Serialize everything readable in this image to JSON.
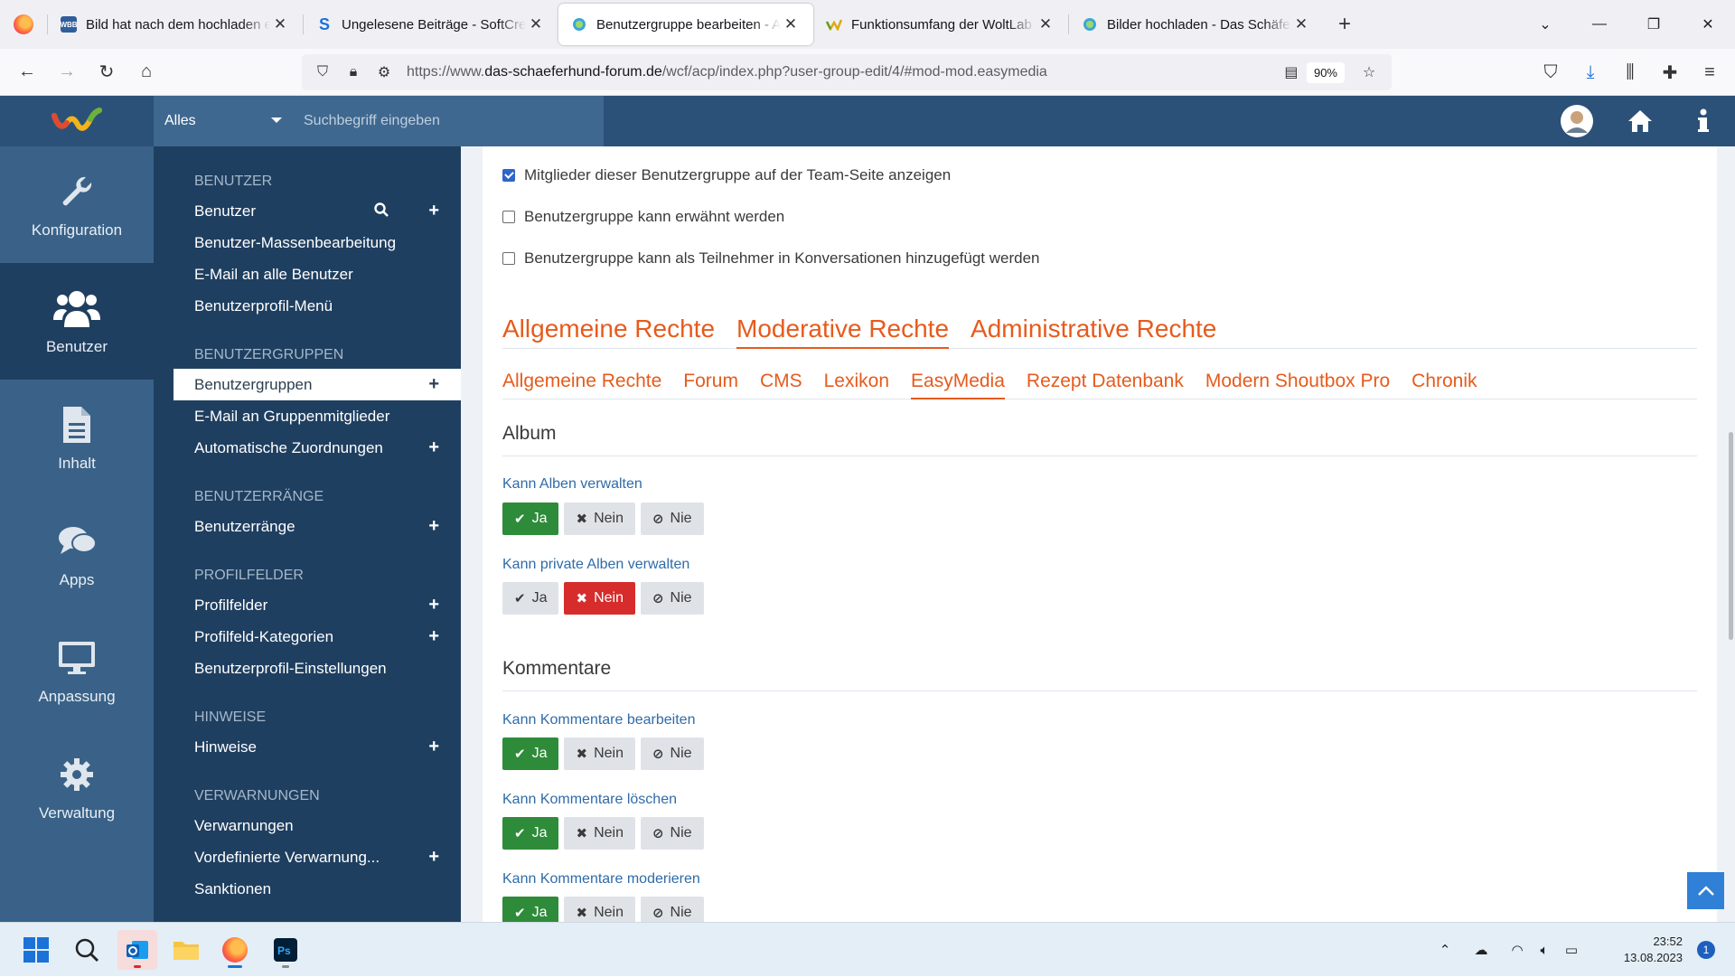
{
  "browser": {
    "tabs": [
      {
        "title": "Bild hat nach dem hochladen ein",
        "favicon": "wbb-favicon",
        "active": false
      },
      {
        "title": "Ungelesene Beiträge - SoftCrea",
        "favicon": "softcreatr-favicon",
        "active": false
      },
      {
        "title": "Benutzergruppe bearbeiten - Ad",
        "favicon": "schaeferhund-favicon",
        "active": true
      },
      {
        "title": "Funktionsumfang der WoltLab Su",
        "favicon": "woltlab-favicon",
        "active": false
      },
      {
        "title": "Bilder hochladen - Das Schäferh",
        "favicon": "schaeferhund-favicon",
        "active": false
      }
    ],
    "url_scheme": "https://www.",
    "url_domain": "das-schaeferhund-forum.de",
    "url_path": "/wcf/acp/index.php?user-group-edit/4/#mod-mod.easymedia",
    "zoom": "90%"
  },
  "acp": {
    "search_type": "Alles",
    "search_placeholder": "Suchbegriff eingeben",
    "main_menu": [
      {
        "label": "Konfiguration",
        "icon": "wrench-icon"
      },
      {
        "label": "Benutzer",
        "icon": "users-icon",
        "active": true
      },
      {
        "label": "Inhalt",
        "icon": "document-icon"
      },
      {
        "label": "Apps",
        "icon": "comments-icon"
      },
      {
        "label": "Anpassung",
        "icon": "monitor-icon"
      },
      {
        "label": "Verwaltung",
        "icon": "gear-icon"
      }
    ],
    "sub_menu": {
      "benutzer": {
        "heading": "Benutzer",
        "items": [
          "Benutzer",
          "Benutzer-Massenbearbeitung",
          "E-Mail an alle Benutzer",
          "Benutzerprofil-Menü"
        ]
      },
      "gruppen": {
        "heading": "Benutzergruppen",
        "items": [
          "Benutzergruppen",
          "E-Mail an Gruppenmitglieder",
          "Automatische Zuordnungen"
        ]
      },
      "raenge": {
        "heading": "Benutzerränge",
        "items": [
          "Benutzerränge"
        ]
      },
      "profilfelder": {
        "heading": "Profilfelder",
        "items": [
          "Profilfelder",
          "Profilfeld-Kategorien",
          "Benutzerprofil-Einstellungen"
        ]
      },
      "hinweise": {
        "heading": "Hinweise",
        "items": [
          "Hinweise"
        ]
      },
      "verwarnungen": {
        "heading": "Verwarnungen",
        "items": [
          "Verwarnungen",
          "Vordefinierte Verwarnung...",
          "Sanktionen"
        ]
      }
    },
    "checkboxes": [
      {
        "label": "Mitglieder dieser Benutzergruppe auf der Team-Seite anzeigen",
        "checked": true
      },
      {
        "label": "Benutzergruppe kann erwähnt werden",
        "checked": false
      },
      {
        "label": "Benutzergruppe kann als Teilnehmer in Konversationen hinzugefügt werden",
        "checked": false
      }
    ],
    "right_tabs": [
      "Allgemeine Rechte",
      "Moderative Rechte",
      "Administrative Rechte"
    ],
    "active_right_tab": "Moderative Rechte",
    "sub_tabs": [
      "Allgemeine Rechte",
      "Forum",
      "CMS",
      "Lexikon",
      "EasyMedia",
      "Rezept Datenbank",
      "Modern Shoutbox Pro",
      "Chronik"
    ],
    "active_sub_tab": "EasyMedia",
    "buttons": {
      "ja": "Ja",
      "nein": "Nein",
      "nie": "Nie"
    },
    "sections": [
      {
        "title": "Album",
        "options": [
          {
            "label": "Kann Alben verwalten",
            "value": "ja"
          },
          {
            "label": "Kann private Alben verwalten",
            "value": "nein"
          }
        ]
      },
      {
        "title": "Kommentare",
        "options": [
          {
            "label": "Kann Kommentare bearbeiten",
            "value": "ja"
          },
          {
            "label": "Kann Kommentare löschen",
            "value": "ja"
          },
          {
            "label": "Kann Kommentare moderieren",
            "value": "ja"
          }
        ]
      }
    ]
  },
  "taskbar": {
    "time": "23:52",
    "date": "13.08.2023",
    "notifications": "1"
  },
  "colors": {
    "header_blue": "#2c5178",
    "sidebar_dark": "#1f3f60",
    "accent_orange": "#e65b1c",
    "ja_green": "#2e8b3a",
    "nein_red": "#d62c2c",
    "label_blue": "#2f6ba8"
  }
}
